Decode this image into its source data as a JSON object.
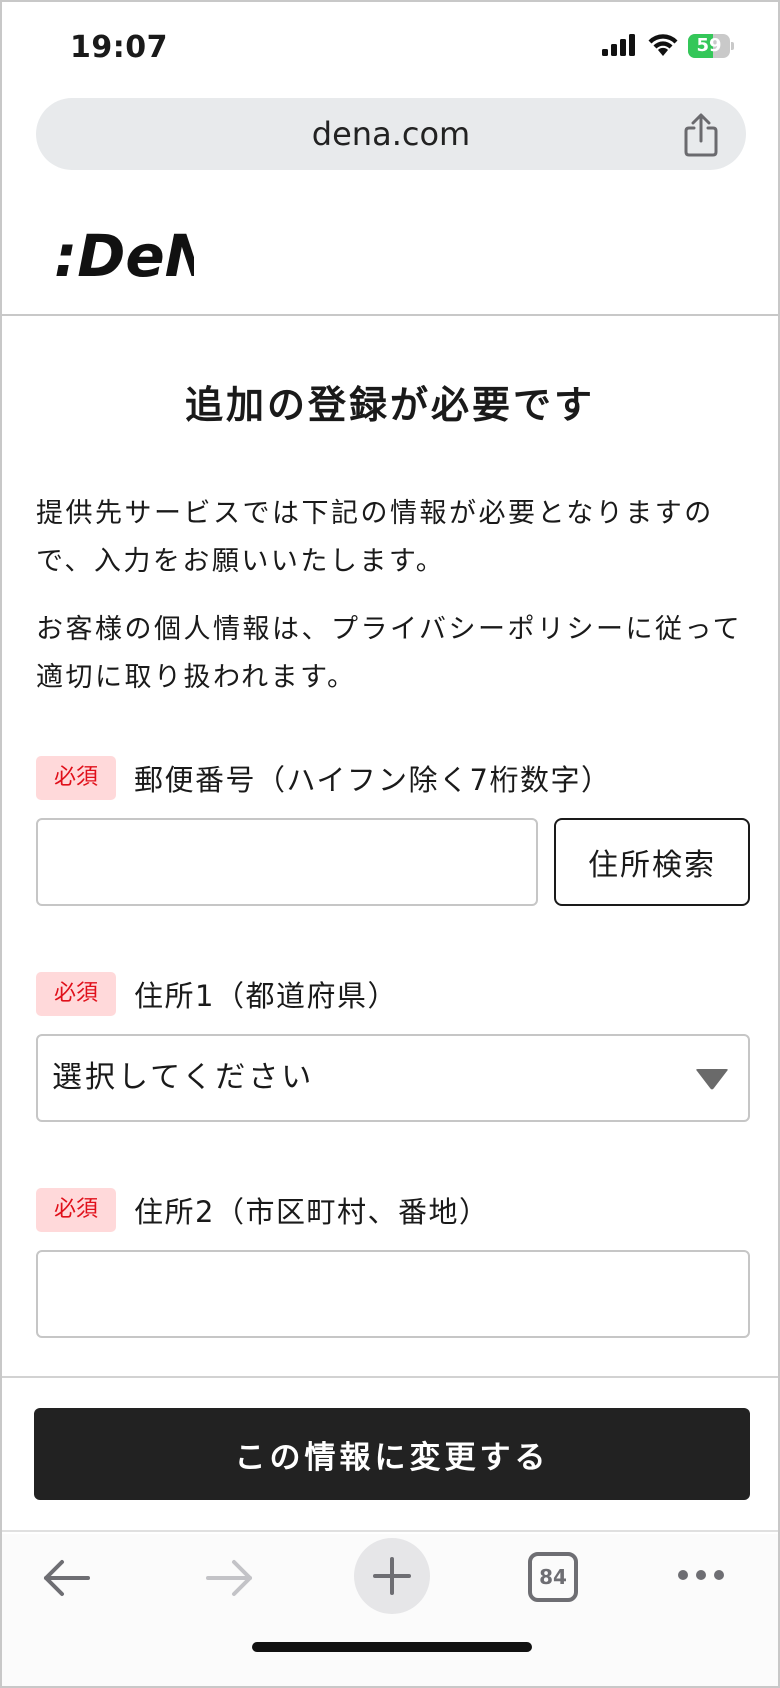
{
  "status_bar": {
    "time": "19:07",
    "battery_percent": 59,
    "battery_label": "59",
    "icons": [
      "signal-icon",
      "wifi-icon",
      "battery-icon"
    ]
  },
  "browser": {
    "url": "dena.com",
    "tab_count": "84",
    "icons": [
      "share-icon",
      "back-icon",
      "forward-icon",
      "plus-icon",
      "tabs-icon",
      "more-icon"
    ]
  },
  "header": {
    "logo_text": ":DeNA"
  },
  "main": {
    "title": "追加の登録が必要です",
    "paragraph_1_line_1": "提供先サービスでは下記の情報が必要となりますの",
    "paragraph_1_line_2": "で、入力をお願いいたします。",
    "paragraph_2_line_1": "お客様の個人情報は、プライバシーポリシーに従って",
    "paragraph_2_line_2": "適切に取り扱われます。"
  },
  "form": {
    "required_label": "必須",
    "postal": {
      "label": "郵便番号（ハイフン除く7桁数字）",
      "value": "",
      "search_label": "住所検索"
    },
    "prefecture": {
      "label": "住所1（都道府県）",
      "selected": "選択してください"
    },
    "address2": {
      "label": "住所2（市区町村、番地）",
      "value": ""
    },
    "submit_label": "この情報に変更する"
  },
  "colors": {
    "required_bg": "#ffd9da",
    "required_text": "#e0101a",
    "submit_bg": "#222222",
    "battery_green": "#34c759"
  }
}
